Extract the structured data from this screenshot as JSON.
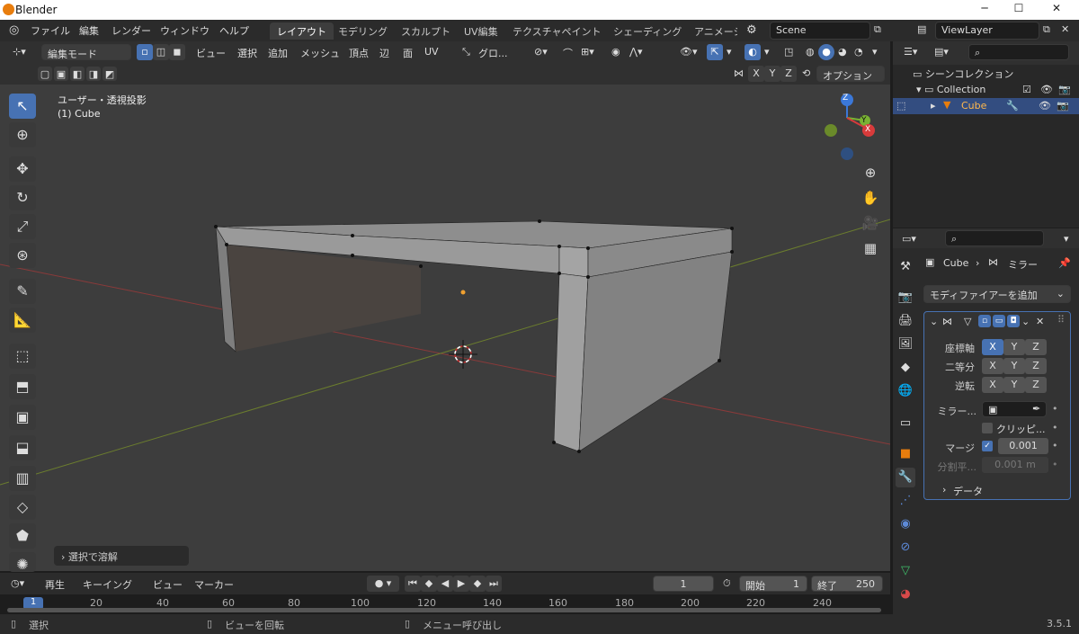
{
  "window": {
    "title": "Blender",
    "minimize": "─",
    "maximize": "☐",
    "close": "✕"
  },
  "menu": [
    "ファイル",
    "編集",
    "レンダー",
    "ウィンドウ",
    "ヘルプ"
  ],
  "workspaces": [
    "レイアウト",
    "モデリング",
    "スカルプト",
    "UV編集",
    "テクスチャペイント",
    "シェーディング",
    "アニメーシ"
  ],
  "scene": {
    "label": "Scene",
    "viewlayer": "ViewLayer"
  },
  "viewport_header": {
    "mode": "編集モード",
    "menus": [
      "ビュー",
      "選択",
      "追加",
      "メッシュ",
      "頂点",
      "辺",
      "面",
      "UV"
    ],
    "transform": "グロ...",
    "options": "オプション",
    "axes": [
      "X",
      "Y",
      "Z"
    ]
  },
  "viewport": {
    "view_name": "ユーザー・透視投影",
    "object_name": "(1) Cube",
    "operator_panel": "選択で溶解",
    "gizmo": {
      "z": "Z",
      "y": "Y",
      "x": "X"
    }
  },
  "timeline": {
    "menus": [
      "再生",
      "キーイング",
      "ビュー",
      "マーカー"
    ],
    "current_frame": "1",
    "start_label": "開始",
    "start": "1",
    "end_label": "終了",
    "end": "250",
    "ruler": [
      "1",
      "20",
      "40",
      "60",
      "80",
      "100",
      "120",
      "140",
      "160",
      "180",
      "200",
      "220",
      "240"
    ]
  },
  "status": {
    "select": "選択",
    "rotate": "ビューを回転",
    "menu": "メニュー呼び出し",
    "version": "3.5.1"
  },
  "outliner": {
    "root": "シーンコレクション",
    "collection": "Collection",
    "object": "Cube"
  },
  "properties": {
    "breadcrumb_object": "Cube",
    "breadcrumb_modifier": "ミラー",
    "add_modifier": "モディファイアーを追加",
    "rows": {
      "axis": "座標軸",
      "bisect": "二等分",
      "flip": "逆転",
      "mirror_object": "ミラー...",
      "clipping": "クリッピ...",
      "merge": "マージ",
      "merge_value": "0.001",
      "bisect_dist": "分割平...",
      "bisect_dist_value": "0.001 m",
      "data": "データ"
    }
  },
  "colors": {
    "accent": "#4772b3",
    "object_orange": "#e87d0d",
    "axis_x": "#c0392b",
    "axis_y": "#7a9a2a"
  }
}
